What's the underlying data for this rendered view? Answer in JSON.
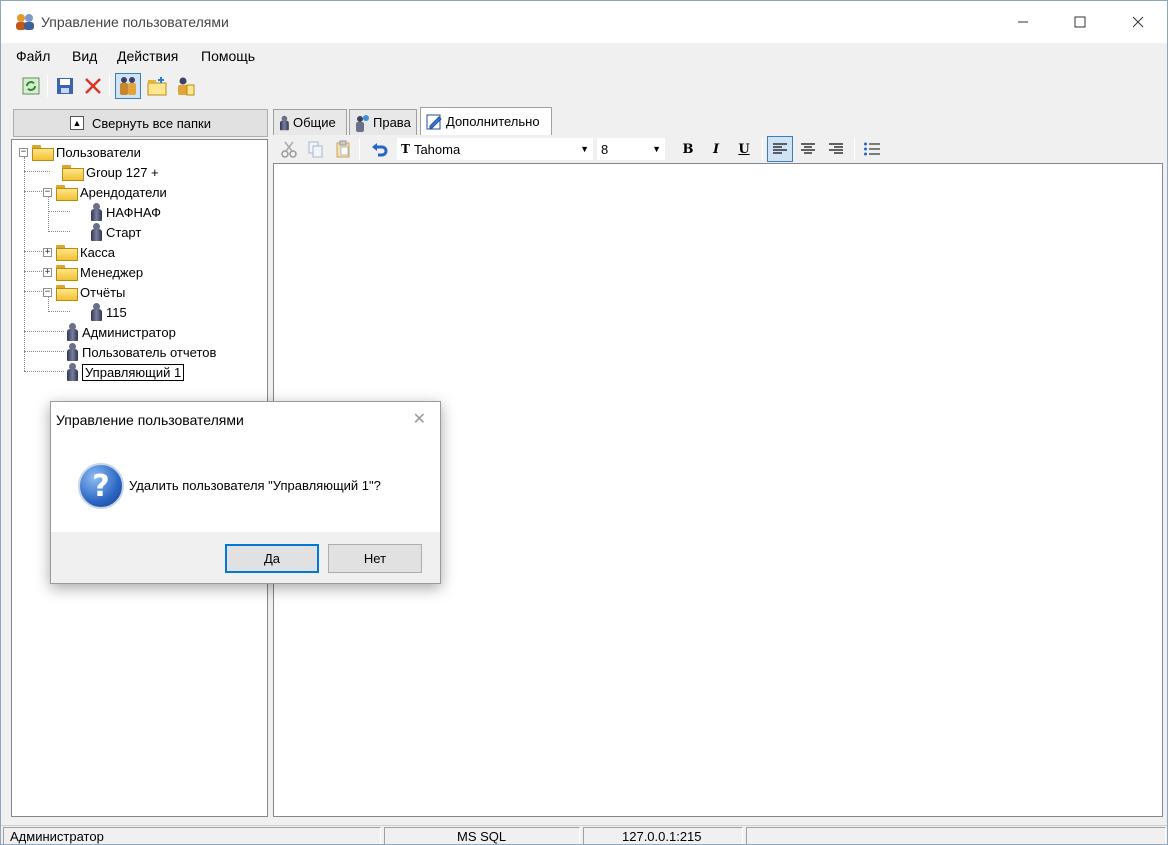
{
  "window": {
    "title": "Управление пользователями"
  },
  "menu": [
    "Файл",
    "Вид",
    "Действия",
    "Помощь"
  ],
  "toolbar": {
    "icons": [
      "refresh-icon",
      "save-icon",
      "delete-icon",
      "users-icon",
      "add-folder-icon",
      "add-user-icon"
    ]
  },
  "left": {
    "collapse_label": "Свернуть все папки",
    "tree": {
      "root": "Пользователи",
      "group127": "Group 127 +",
      "arend": "Арендодатели",
      "nafnaf": "НАФНАФ",
      "start": "Старт",
      "kassa": "Касса",
      "manager": "Менеджер",
      "otchety": "Отчёты",
      "u115": "115",
      "admin": "Администратор",
      "reports_user": "Пользователь отчетов",
      "upr1": "Управляющий 1"
    }
  },
  "tabs": [
    "Общие",
    "Права",
    "Дополнительно"
  ],
  "editor": {
    "font_name": "Tahoma",
    "font_size": "8",
    "bold": "B",
    "italic": "I",
    "underline": "U"
  },
  "status": {
    "user": "Администратор",
    "db": "MS SQL",
    "server": "127.0.0.1:215"
  },
  "dialog": {
    "title": "Управление пользователями",
    "message": "Удалить пользователя \"Управляющий 1\"?",
    "yes": "Да",
    "no": "Нет"
  }
}
